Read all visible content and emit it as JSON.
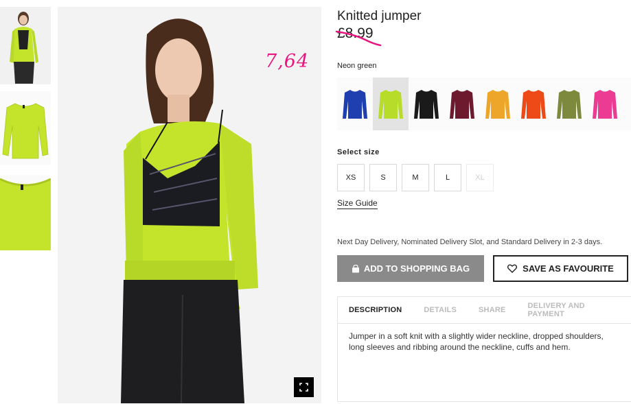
{
  "product": {
    "title": "Knitted jumper",
    "price": "£8.99",
    "handwritten_price": "7,64",
    "color_name": "Neon green"
  },
  "swatches": [
    {
      "name": "blue",
      "color": "#1f3fb0"
    },
    {
      "name": "neon-green",
      "color": "#b8dc2a",
      "selected": true
    },
    {
      "name": "black",
      "color": "#1a1a1a"
    },
    {
      "name": "burgundy",
      "color": "#6e1a2e"
    },
    {
      "name": "mustard",
      "color": "#eda52a"
    },
    {
      "name": "orange-red",
      "color": "#ee4a17"
    },
    {
      "name": "khaki",
      "color": "#7d8a3e"
    },
    {
      "name": "pink",
      "color": "#ec3b93"
    }
  ],
  "size": {
    "label": "Select size",
    "options": [
      "XS",
      "S",
      "M",
      "L",
      "XL"
    ],
    "guide": "Size Guide"
  },
  "delivery_note": "Next Day Delivery, Nominated Delivery Slot, and Standard Delivery in 2-3 days.",
  "buttons": {
    "add_to_bag": "ADD TO SHOPPING BAG",
    "save_favourite": "SAVE AS FAVOURITE"
  },
  "tabs": [
    "DESCRIPTION",
    "DETAILS",
    "SHARE",
    "DELIVERY AND PAYMENT"
  ],
  "description": "Jumper in a soft knit with a slightly wider neckline, dropped shoulders, long sleeves and ribbing around the neckline, cuffs and hem.",
  "colors": {
    "accent_pink": "#e8157f",
    "button_grey": "#8a8a8a",
    "neon_green": "#c4e42c"
  }
}
